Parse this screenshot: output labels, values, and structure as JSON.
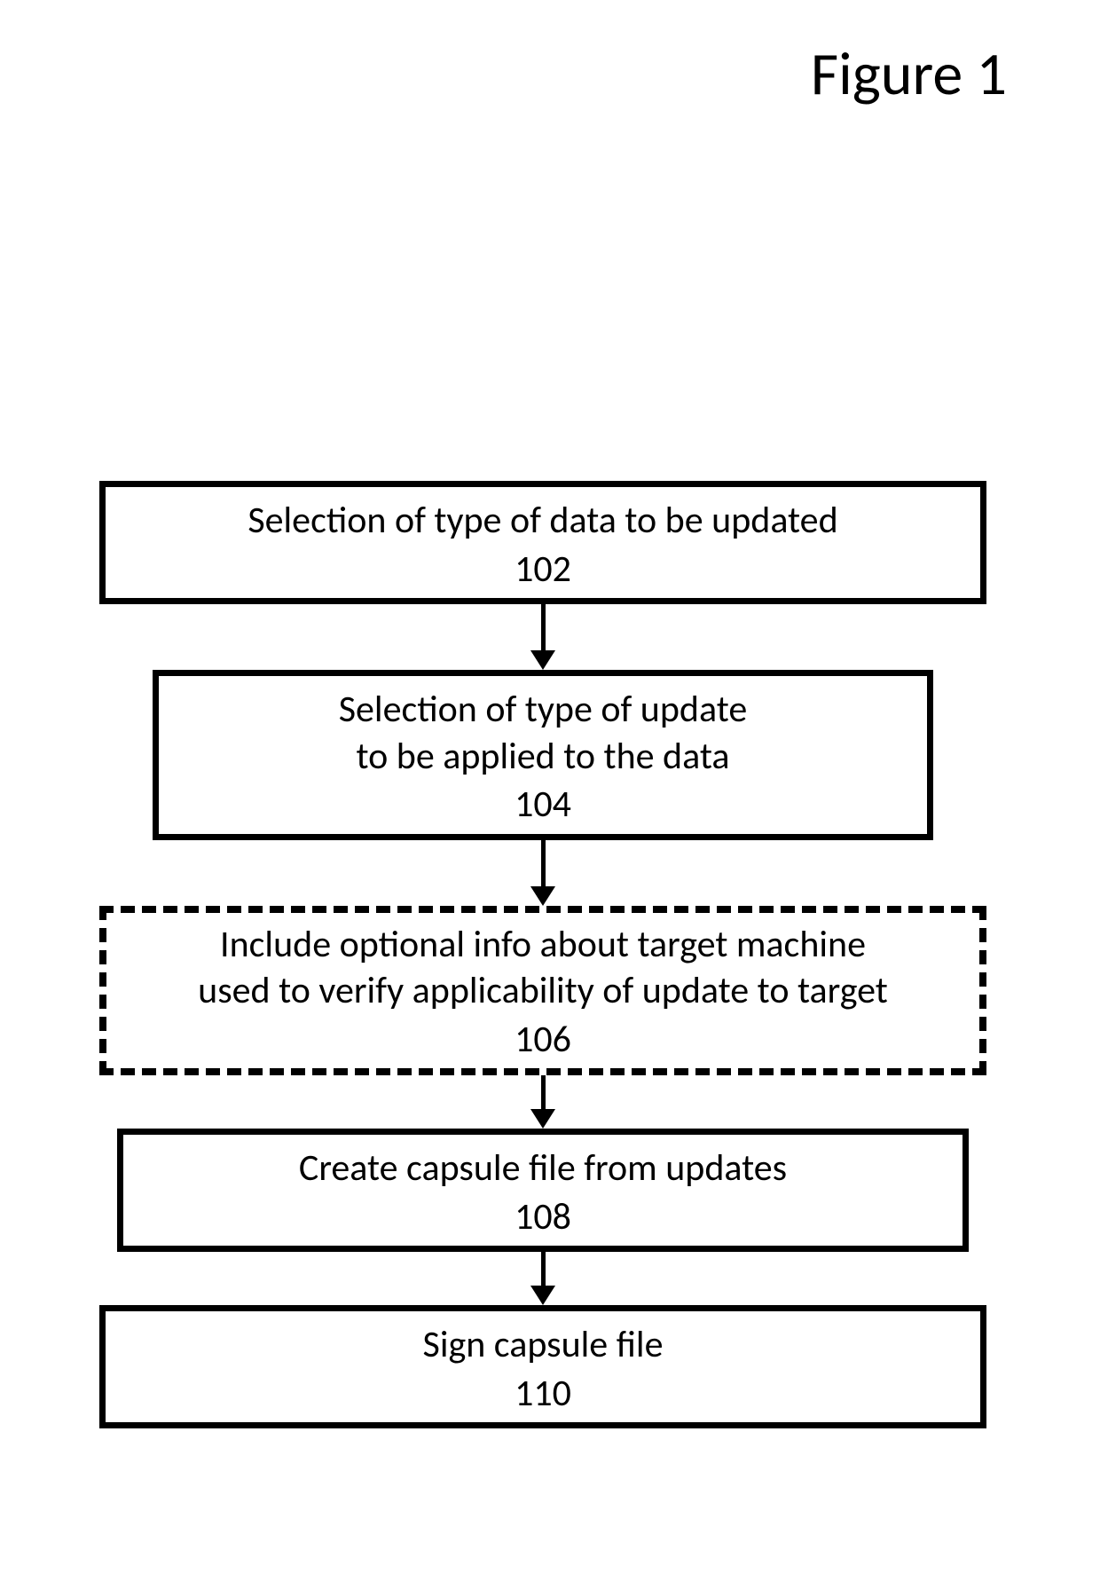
{
  "figure_title": "Figure 1",
  "steps": {
    "s102": {
      "text": "Selection of type of data to be updated",
      "num": "102"
    },
    "s104": {
      "text_l1": "Selection of type of update",
      "text_l2": "to be applied to the data",
      "num": "104"
    },
    "s106": {
      "text_l1": "Include optional info about target machine",
      "text_l2": "used to verify applicability of update to target",
      "num": "106"
    },
    "s108": {
      "text": "Create capsule file from updates",
      "num": "108"
    },
    "s110": {
      "text": "Sign capsule file",
      "num": "110"
    }
  }
}
